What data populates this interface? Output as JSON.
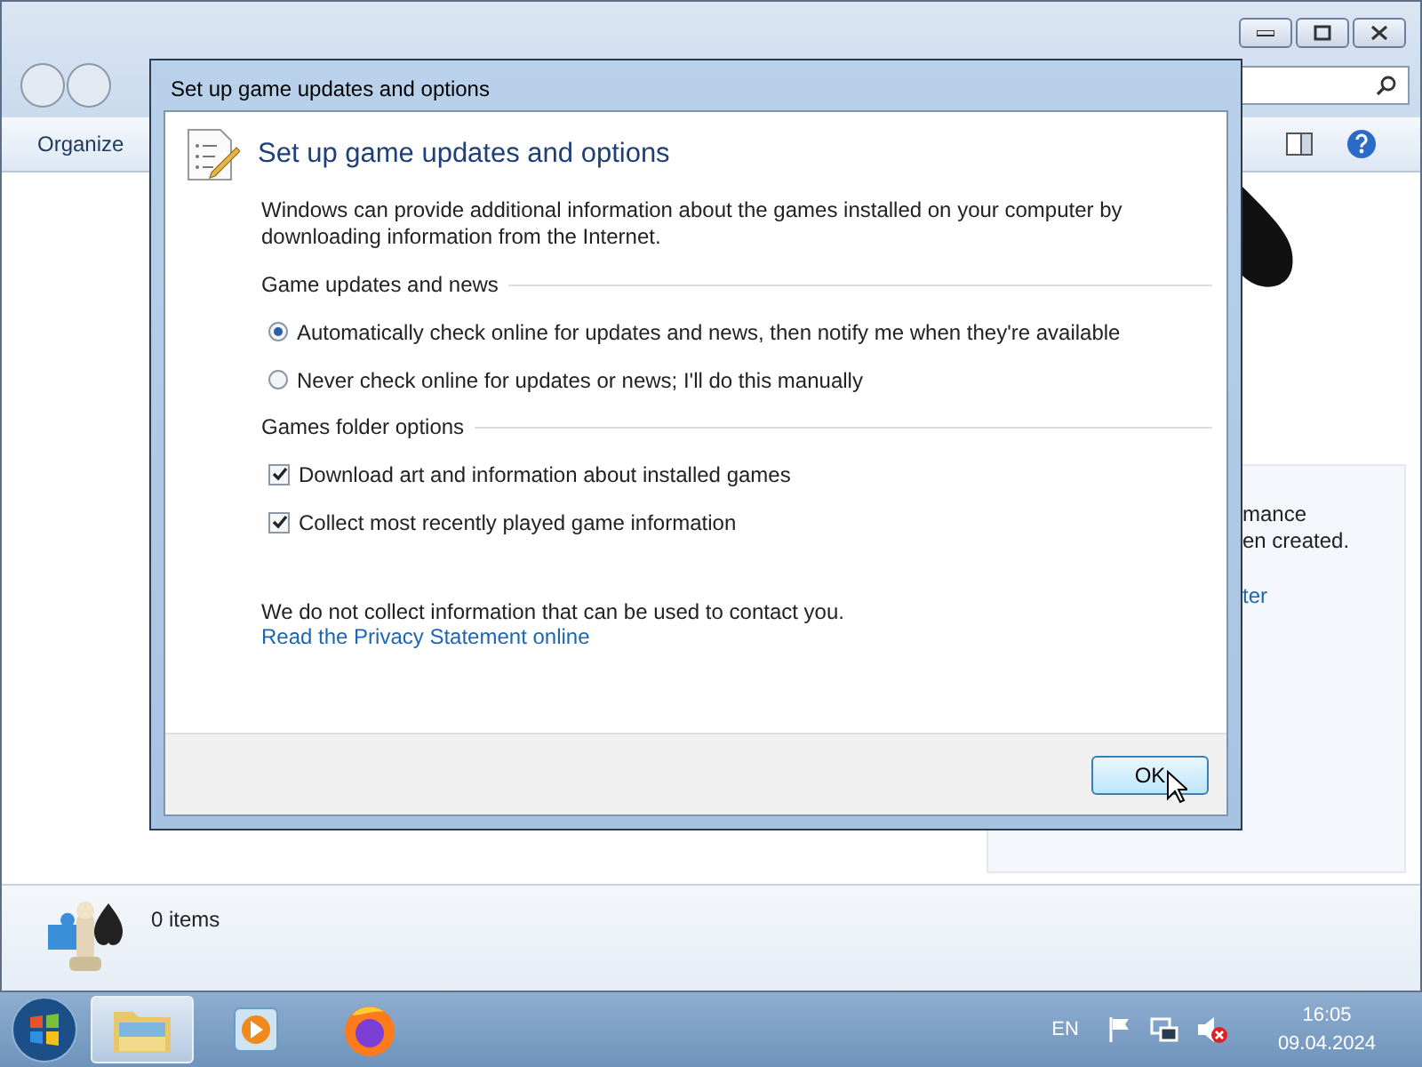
{
  "explorer": {
    "toolbar": {
      "organize": "Organize"
    },
    "side_panel": {
      "lines": [
        "mance",
        "en created."
      ],
      "link": "ter"
    },
    "details": {
      "count": "0 items"
    }
  },
  "dialog": {
    "title": "Set up game updates and options",
    "heading": "Set up game updates and options",
    "intro": "Windows can provide additional information about the games installed on your computer by downloading information from the Internet.",
    "sections": [
      {
        "title": "Game updates and news",
        "options": [
          {
            "kind": "radio",
            "label": "Automatically check online for updates and news, then notify me when they're available",
            "selected": true
          },
          {
            "kind": "radio",
            "label": "Never check online for updates or news; I'll do this manually",
            "selected": false
          }
        ]
      },
      {
        "title": "Games folder options",
        "options": [
          {
            "kind": "checkbox",
            "label": "Download art and information about installed games",
            "checked": true
          },
          {
            "kind": "checkbox",
            "label": "Collect most recently played game information",
            "checked": true
          }
        ]
      }
    ],
    "privacy_note": "We do not collect information that can be used to contact you.",
    "privacy_link": "Read the Privacy Statement online",
    "ok_button": "OK"
  },
  "taskbar": {
    "language": "EN",
    "time": "16:05",
    "date": "09.04.2024"
  }
}
